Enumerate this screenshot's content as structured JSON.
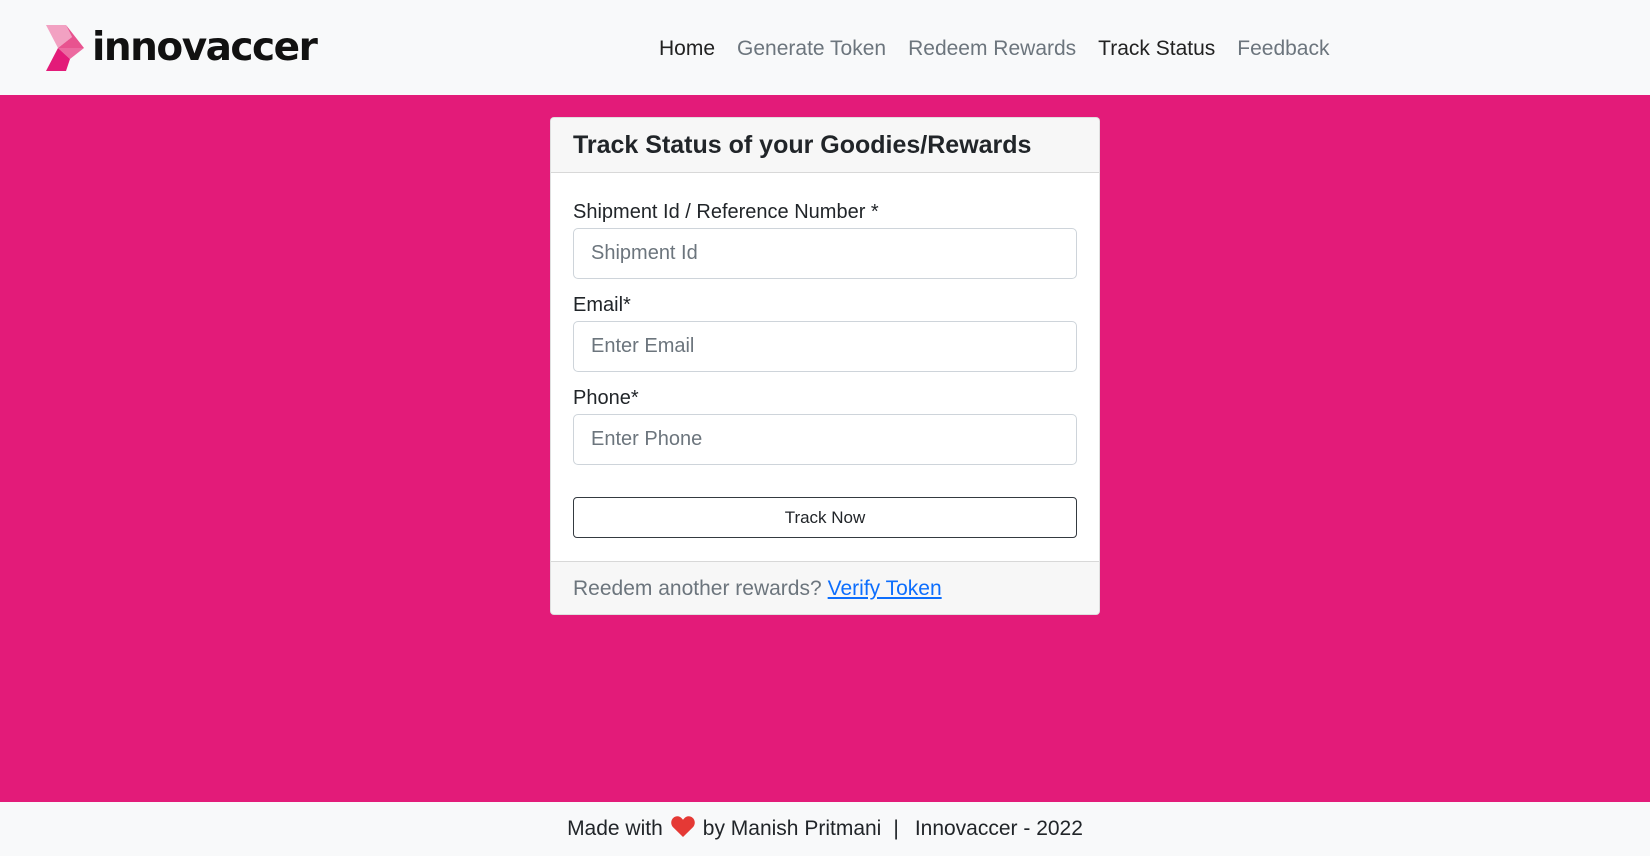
{
  "brand": {
    "name": "innovaccer",
    "logo_colors": [
      "#f2a1c2",
      "#e8538f",
      "#e31b79"
    ]
  },
  "nav": {
    "items": [
      {
        "label": "Home",
        "active": true
      },
      {
        "label": "Generate Token",
        "active": false
      },
      {
        "label": "Redeem Rewards",
        "active": false
      },
      {
        "label": "Track Status",
        "active": true
      },
      {
        "label": "Feedback",
        "active": false
      }
    ]
  },
  "form": {
    "title": "Track Status of your Goodies/Rewards",
    "shipment": {
      "label": "Shipment Id / Reference Number *",
      "placeholder": "Shipment Id",
      "value": ""
    },
    "email": {
      "label": "Email*",
      "placeholder": "Enter Email",
      "value": ""
    },
    "phone": {
      "label": "Phone*",
      "placeholder": "Enter Phone",
      "value": ""
    },
    "submit_label": "Track Now",
    "footer_text": "Reedem another rewards?",
    "footer_link": "Verify Token"
  },
  "footer": {
    "made_with": "Made with",
    "heart_icon": "heart-icon",
    "by": "by Manish Pritmani",
    "separator": "|",
    "company": "Innovaccer - 2022"
  },
  "colors": {
    "page_background": "#e31b79",
    "navbar_background": "#f8f9fa",
    "link": "#0d6efd",
    "heart": "#e53935"
  }
}
